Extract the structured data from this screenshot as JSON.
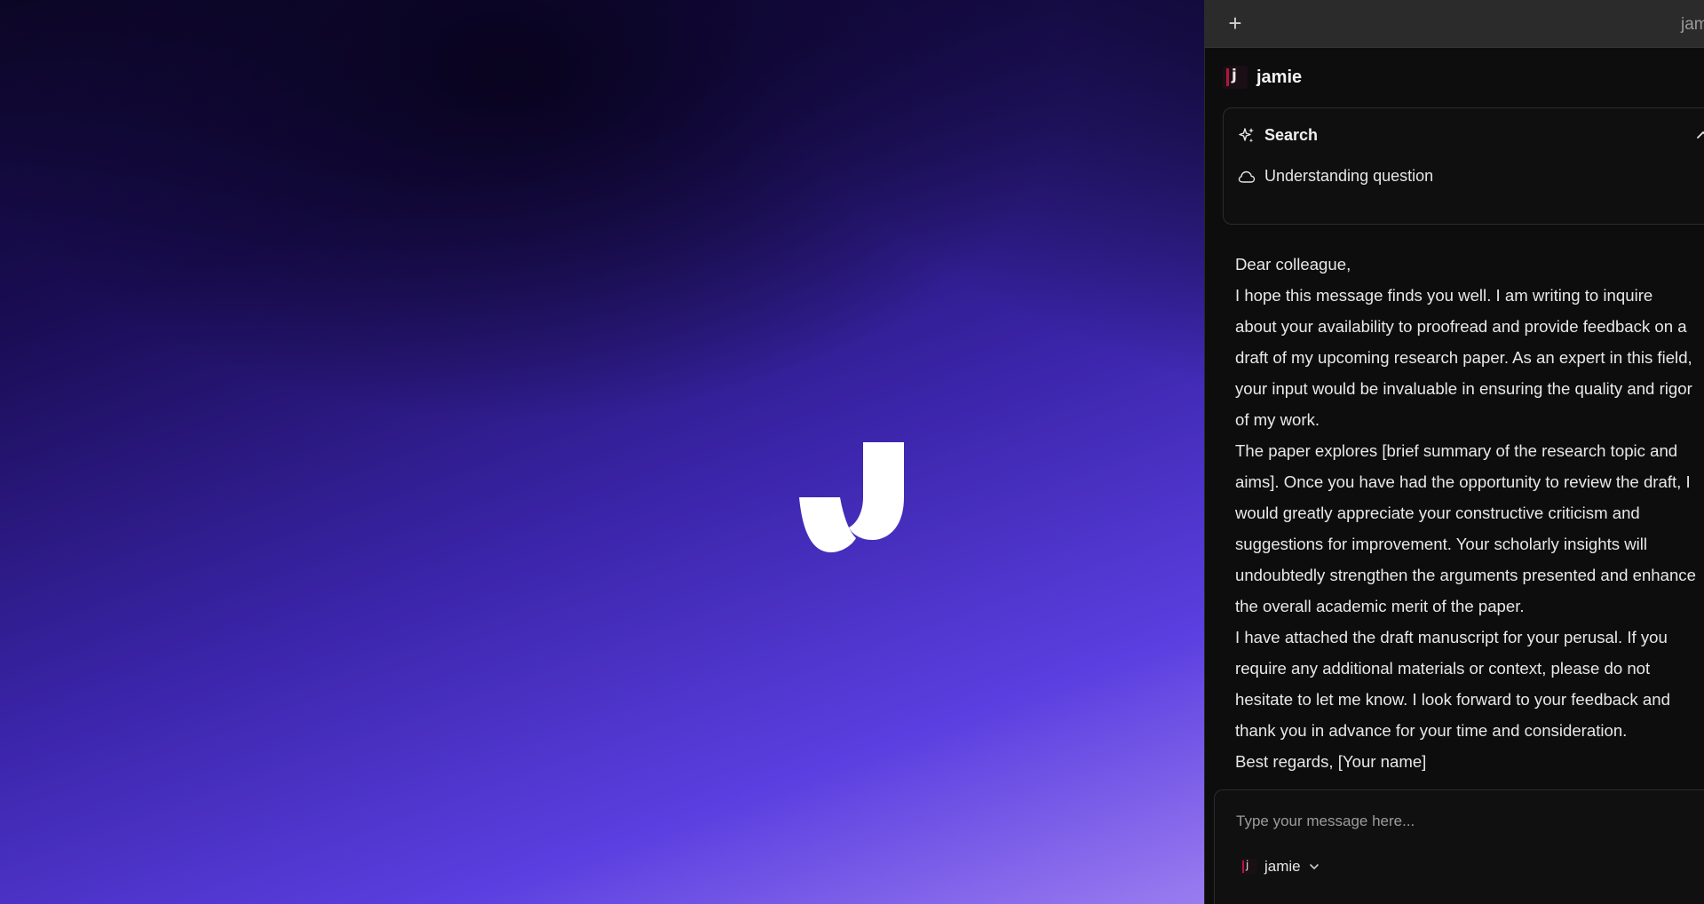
{
  "window": {
    "plus_label": "+",
    "title": "jamie"
  },
  "account": {
    "name": "jamie",
    "avatar_icon": "jamie-avatar-icon"
  },
  "search_card": {
    "title": "Search",
    "title_icon": "sparkle-search-icon",
    "status": "Understanding question",
    "status_icon": "cloud-icon",
    "collapse_icon": "chevron-up-icon"
  },
  "message": {
    "paragraphs": [
      "Dear colleague,",
      "I hope this message finds you well. I am writing to inquire about your availability to proofread and provide feedback on a draft of my upcoming research paper. As an expert in this field, your input would be invaluable in ensuring the quality and rigor of my work.",
      "The paper explores [brief summary of the research topic and aims]. Once you have had the opportunity to review the draft, I would greatly appreciate your constructive criticism and suggestions for improvement. Your scholarly insights will undoubtedly strengthen the arguments presented and enhance the overall academic merit of the paper.",
      "I have attached the draft manuscript for your perusal. If you require any additional materials or context, please do not hesitate to let me know. I look forward to your feedback and thank you in advance for your time and consideration.",
      "Best regards, [Your name]"
    ]
  },
  "composer": {
    "placeholder": "Type your message here...",
    "model": "jamie",
    "model_icon": "chevron-down-icon"
  },
  "colors": {
    "panel_bg": "#0d0d0d",
    "topbar_bg": "#2b2b2b",
    "accent_purple": "#5b3fe0"
  }
}
